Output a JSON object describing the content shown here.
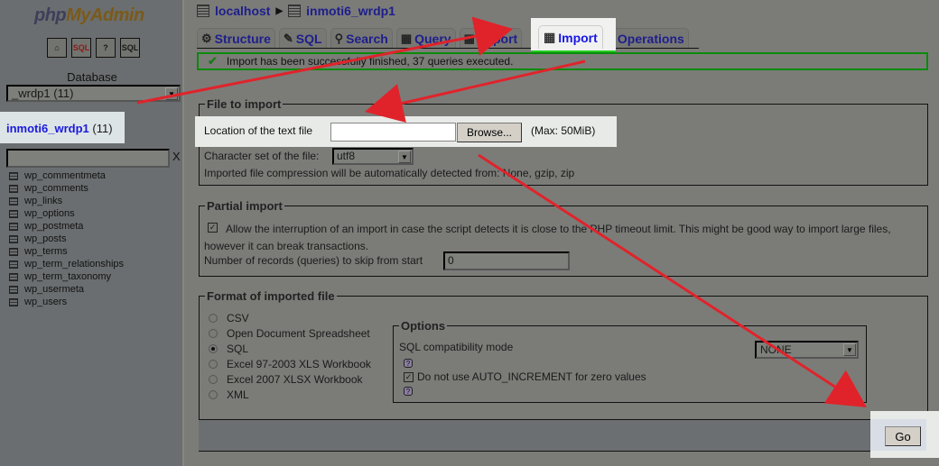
{
  "sidebar": {
    "logo_php": "php",
    "logo_myadmin": "MyAdmin",
    "icons": [
      "home-icon",
      "sql-query-icon",
      "help-icon",
      "sql-docs-icon"
    ],
    "icon_labels": [
      "⌂",
      "SQL",
      "?",
      "SQL"
    ],
    "database_label": "Database",
    "database_select_value": "_wrdp1 (11)",
    "current_db_name": "inmoti6_wrdp1",
    "current_db_count": "(11)",
    "filter_value": "",
    "filter_clear": "X",
    "tables": [
      "wp_commentmeta",
      "wp_comments",
      "wp_links",
      "wp_options",
      "wp_postmeta",
      "wp_posts",
      "wp_terms",
      "wp_term_relationships",
      "wp_term_taxonomy",
      "wp_usermeta",
      "wp_users"
    ]
  },
  "breadcrumb": {
    "server": "localhost",
    "database": "inmoti6_wrdp1"
  },
  "tabs": [
    {
      "label": "Structure",
      "icon": "⚙"
    },
    {
      "label": "SQL",
      "icon": "✎"
    },
    {
      "label": "Search",
      "icon": "⚲"
    },
    {
      "label": "Query",
      "icon": "▦"
    },
    {
      "label": "Export",
      "icon": "▦"
    },
    {
      "label": "Import",
      "icon": "▦",
      "active": true
    },
    {
      "label": "Operations",
      "icon": "⚒"
    }
  ],
  "message": {
    "icon": "✔",
    "text": "Import has been successfully finished, 37 queries executed."
  },
  "file_section": {
    "legend": "File to import",
    "location_label": "Location of the text file",
    "file_value": "",
    "browse_label": "Browse...",
    "max_label": "(Max: 50MiB)",
    "charset_label": "Character set of the file:",
    "charset_value": "utf8",
    "compression_text": "Imported file compression will be automatically detected from: None, gzip, zip"
  },
  "partial_section": {
    "legend": "Partial import",
    "allow_checked": true,
    "allow_text": "Allow the interruption of an import in case the script detects it is close to the PHP timeout limit. This might be good way to import large files, however it can break transactions.",
    "skip_label": "Number of records (queries) to skip from start",
    "skip_value": "0"
  },
  "format_section": {
    "legend": "Format of imported file",
    "formats": [
      {
        "label": "CSV",
        "selected": false
      },
      {
        "label": "Open Document Spreadsheet",
        "selected": false
      },
      {
        "label": "SQL",
        "selected": true
      },
      {
        "label": "Excel 97-2003 XLS Workbook",
        "selected": false
      },
      {
        "label": "Excel 2007 XLSX Workbook",
        "selected": false
      },
      {
        "label": "XML",
        "selected": false
      }
    ],
    "options_legend": "Options",
    "compat_label": "SQL compatibility mode",
    "compat_value": "NONE",
    "autoinc_checked": true,
    "autoinc_label": "Do not use AUTO_INCREMENT for zero values",
    "help_glyph": "?"
  },
  "go_label": "Go",
  "dropdown_glyph": "▼",
  "check_glyph": "✓",
  "annotation_color": "#e0232b"
}
